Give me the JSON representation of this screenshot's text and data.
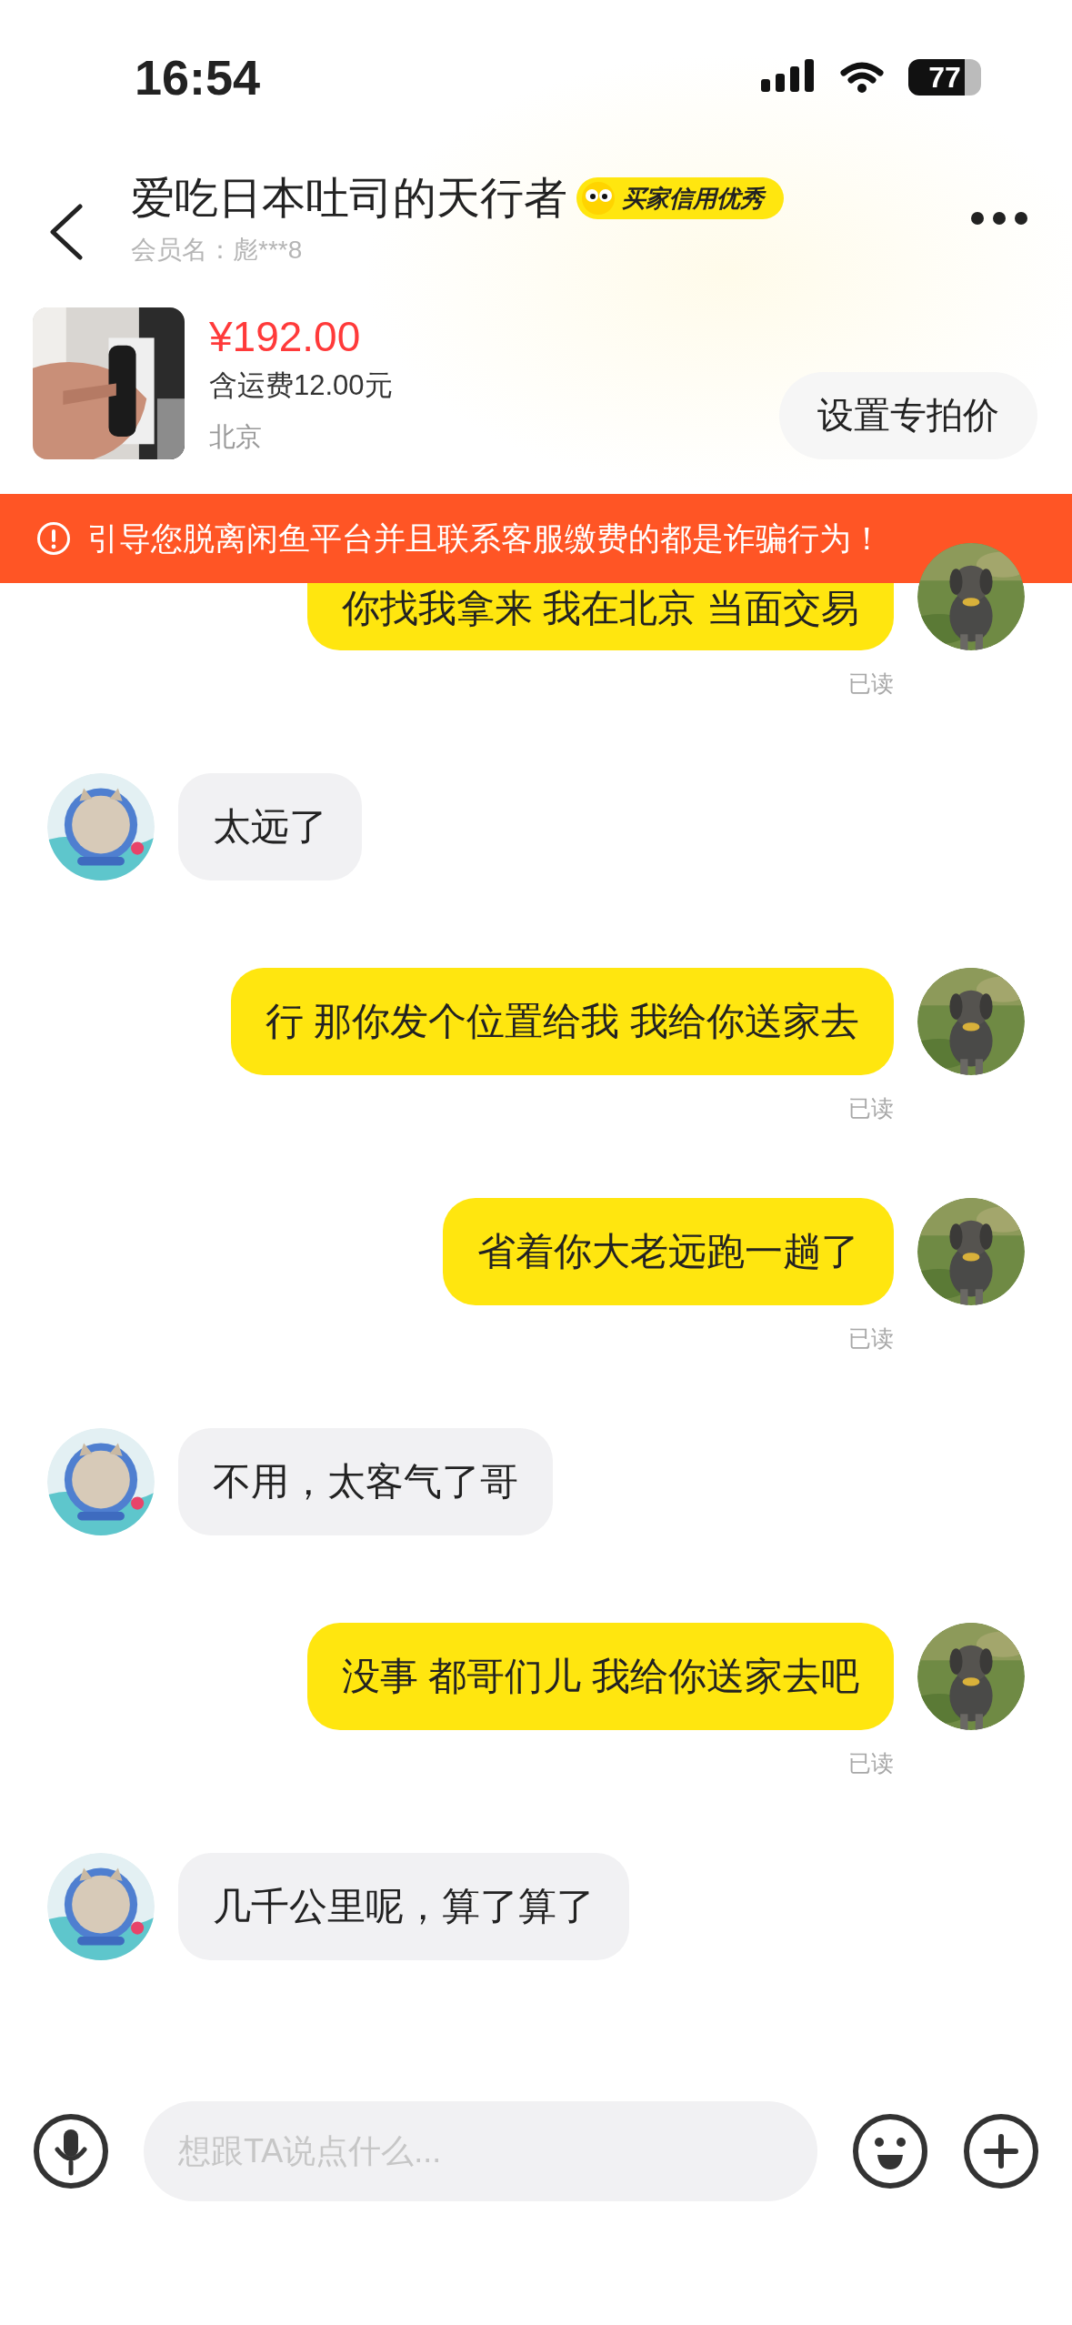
{
  "status_bar": {
    "time": "16:54",
    "battery": "77"
  },
  "header": {
    "title": "爱吃日本吐司的天行者",
    "badge": "买家信用优秀",
    "member": "会员名：彪***8"
  },
  "product": {
    "kind": "picture",
    "price": "¥192.00",
    "shipping": "含运费12.00元",
    "location": "北京",
    "action": "设置专拍价"
  },
  "warning": {
    "text": "引导您脱离闲鱼平台并且联系客服缴费的都是诈骗行为！"
  },
  "messages": [
    {
      "kind": "sent",
      "text": "你找我拿来 我在北京 当面交易",
      "status": "已读"
    },
    {
      "kind": "received",
      "text": "太远了"
    },
    {
      "kind": "sent",
      "text": "行 那你发个位置给我 我给你送家去",
      "status": "已读"
    },
    {
      "kind": "sent",
      "text": "省着你大老远跑一趟了",
      "status": "已读"
    },
    {
      "kind": "received",
      "text": "不用，太客气了哥"
    },
    {
      "kind": "sent",
      "text": "没事 都哥们儿 我给你送家去吧",
      "status": "已读"
    },
    {
      "kind": "received",
      "text": "几千公里呢，算了算了"
    }
  ],
  "input": {
    "placeholder": "想跟TA说点什么..."
  }
}
